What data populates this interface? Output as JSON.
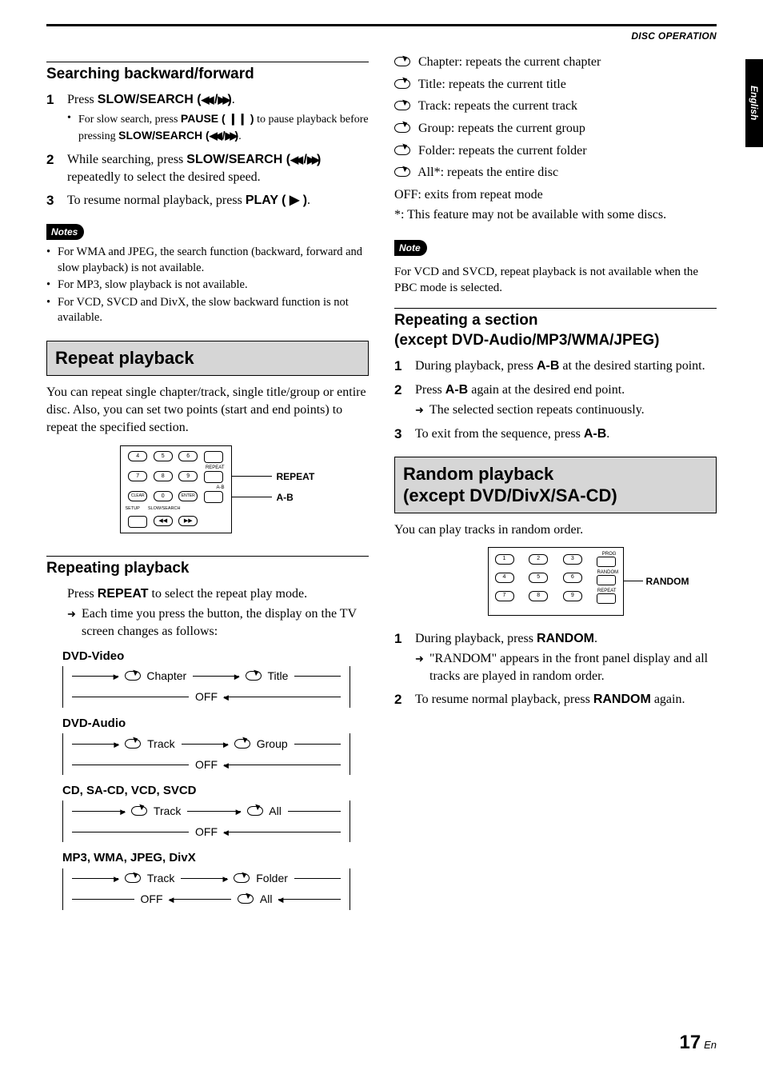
{
  "header": {
    "category": "DISC OPERATION",
    "side_tab": "English"
  },
  "left": {
    "search": {
      "title": "Searching backward/forward",
      "steps": [
        {
          "pre": "Press ",
          "bold": "SLOW/SEARCH (",
          "icons": "◀◀ /▶▶",
          "bold2": ")",
          "post": ".",
          "sub": [
            {
              "t1": "For slow search, press ",
              "b1": "PAUSE ( ❙❙ )",
              "t2": " to pause playback before pressing ",
              "b2": "SLOW/SEARCH (",
              "ic": "◀◀ /▶▶",
              "b3": ")",
              "t3": "."
            }
          ]
        },
        {
          "pre": "While searching, press ",
          "bold": "SLOW/SEARCH (",
          "icons": "◀◀ /▶▶",
          "bold2": ")",
          "post": " repeatedly to select the desired speed."
        },
        {
          "pre": "To resume normal playback, press ",
          "bold": "PLAY ( ▶ )",
          "post": "."
        }
      ],
      "notes_label": "Notes",
      "notes": [
        "For WMA and JPEG, the search function (backward, forward and slow playback) is not available.",
        "For MP3, slow playback is not available.",
        "For VCD, SVCD and DivX, the slow backward function is not available."
      ]
    },
    "repeat_box": {
      "title": "Repeat playback",
      "intro": "You can repeat single chapter/track, single title/group or entire disc. Also, you can set two points (start and end points) to repeat the specified section.",
      "callout_repeat": "REPEAT",
      "callout_ab": "A-B",
      "remote": {
        "row1": [
          "4",
          "5",
          "6"
        ],
        "row1_side": "",
        "row2": [
          "7",
          "8",
          "9"
        ],
        "row2_side_lbl": "REPEAT",
        "row3": [
          "CLEAR",
          "0",
          "ENTER"
        ],
        "row3_side_lbl": "A-B",
        "row4_l": "SETUP",
        "row4_c": "SLOW/SEARCH"
      }
    },
    "repeating": {
      "title": "Repeating playback",
      "line1a": "Press ",
      "line1b": "REPEAT",
      "line1c": " to select the repeat play mode.",
      "arrow1": "Each time you press the button, the display on the TV screen changes as follows:",
      "cycles": [
        {
          "title": "DVD-Video",
          "a": "Chapter",
          "b": "Title",
          "off": "OFF"
        },
        {
          "title": "DVD-Audio",
          "a": "Track",
          "b": "Group",
          "off": "OFF"
        },
        {
          "title": "CD, SA-CD, VCD, SVCD",
          "a": "Track",
          "b": "All",
          "off": "OFF"
        },
        {
          "title": "MP3, WMA, JPEG, DivX",
          "a": "Track",
          "b": "Folder",
          "off": "OFF",
          "extra": "All"
        }
      ]
    }
  },
  "right": {
    "repeat_modes": [
      "Chapter: repeats the current chapter",
      "Title: repeats the current title",
      "Track: repeats the current track",
      "Group: repeats the current group",
      "Folder: repeats the current folder",
      "All*: repeats the entire disc"
    ],
    "off_line": "OFF: exits from repeat mode",
    "asterisk": "*: This feature may not be available with some discs.",
    "note_label": "Note",
    "note_text": "For VCD and SVCD, repeat playback is not available when the PBC mode is selected.",
    "section_ab": {
      "title": "Repeating a section\n(except DVD-Audio/MP3/WMA/JPEG)",
      "steps": [
        {
          "t1": "During playback, press ",
          "b": "A-B",
          "t2": " at the desired starting point."
        },
        {
          "t1": "Press ",
          "b": "A-B",
          "t2": " again at the desired end point.",
          "arrow": "The selected section repeats continuously."
        },
        {
          "t1": "To exit from the sequence, press ",
          "b": "A-B",
          "t2": "."
        }
      ]
    },
    "random_box": {
      "title": "Random playback\n(except DVD/DivX/SA-CD)",
      "intro": "You can play tracks in random order.",
      "callout": "RANDOM",
      "remote": {
        "rows": [
          [
            "1",
            "2",
            "3"
          ],
          [
            "4",
            "5",
            "6"
          ],
          [
            "7",
            "8",
            "9"
          ]
        ],
        "side_labels": [
          "PROG",
          "RANDOM",
          "REPEAT"
        ]
      },
      "steps": [
        {
          "t1": "During playback, press ",
          "b": "RANDOM",
          "t2": ".",
          "arrow": "\"RANDOM\" appears in the front panel display and all tracks are played in random order."
        },
        {
          "t1": "To resume normal playback, press ",
          "b": "RANDOM",
          "t2": " again."
        }
      ]
    }
  },
  "page_number": {
    "num": "17",
    "suffix": "En"
  }
}
